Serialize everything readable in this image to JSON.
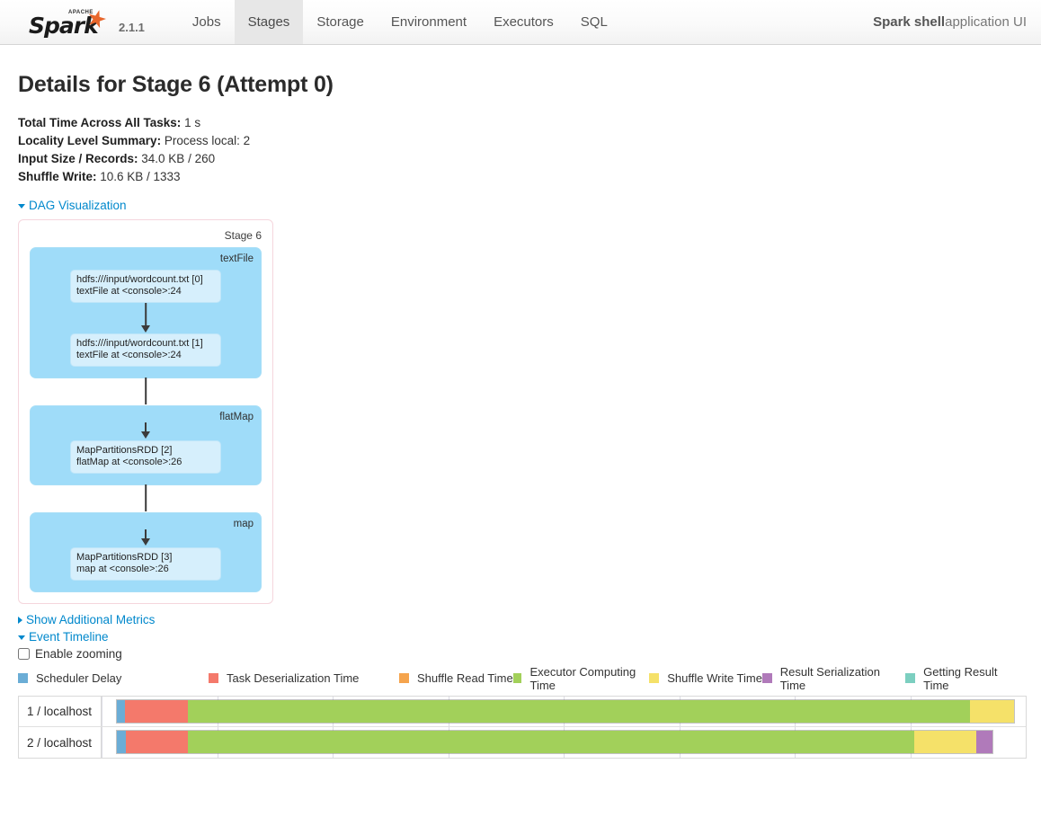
{
  "navbar": {
    "brand": {
      "apache_text": "APACHE",
      "spark_text": "Spark",
      "star_icon": "star-icon",
      "version": "2.1.1"
    },
    "links": [
      {
        "label": "Jobs",
        "active": false
      },
      {
        "label": "Stages",
        "active": true
      },
      {
        "label": "Storage",
        "active": false
      },
      {
        "label": "Environment",
        "active": false
      },
      {
        "label": "Executors",
        "active": false
      },
      {
        "label": "SQL",
        "active": false
      }
    ],
    "app_name": "Spark shell",
    "app_suffix": " application UI"
  },
  "page": {
    "title": "Details for Stage 6 (Attempt 0)",
    "summary": [
      {
        "label": "Total Time Across All Tasks:",
        "value": " 1 s"
      },
      {
        "label": "Locality Level Summary:",
        "value": " Process local: 2"
      },
      {
        "label": "Input Size / Records:",
        "value": " 34.0 KB / 260"
      },
      {
        "label": "Shuffle Write:",
        "value": " 10.6 KB / 1333"
      }
    ],
    "dag_toggle": "DAG Visualization",
    "additional_metrics_toggle": "Show Additional Metrics",
    "event_timeline_toggle": "Event Timeline",
    "enable_zooming_label": "Enable zooming",
    "enable_zooming_checked": false
  },
  "dag": {
    "stage_label": "Stage 6",
    "clusters": [
      {
        "label": "textFile",
        "nodes": [
          {
            "line1": "hdfs:///input/wordcount.txt [0]",
            "line2": "textFile at <console>:24"
          },
          {
            "line1": "hdfs:///input/wordcount.txt [1]",
            "line2": "textFile at <console>:24"
          }
        ]
      },
      {
        "label": "flatMap",
        "nodes": [
          {
            "line1": "MapPartitionsRDD [2]",
            "line2": "flatMap at <console>:26"
          }
        ]
      },
      {
        "label": "map",
        "nodes": [
          {
            "line1": "MapPartitionsRDD [3]",
            "line2": "map at <console>:26"
          }
        ]
      }
    ]
  },
  "legend": [
    {
      "label": "Scheduler Delay",
      "color": "#6badd6"
    },
    {
      "label": "Task Deserialization Time",
      "color": "#f4796b"
    },
    {
      "label": "Shuffle Read Time",
      "color": "#f5a44d"
    },
    {
      "label": "Executor Computing Time",
      "color": "#a2d05a"
    },
    {
      "label": "Shuffle Write Time",
      "color": "#f5e169"
    },
    {
      "label": "Result Serialization Time",
      "color": "#b07aba"
    },
    {
      "label": "Getting Result Time",
      "color": "#7ccfc0"
    }
  ],
  "timeline": {
    "gridlines_pct": [
      0,
      12.5,
      25,
      37.5,
      50,
      62.5,
      75,
      87.5,
      100
    ],
    "rows": [
      {
        "label": "1 / localhost",
        "start_pct": 1.6,
        "end_pct": 98.8,
        "segments": [
          {
            "name": "Scheduler Delay",
            "color": "#6badd6",
            "width_pct": 0.9
          },
          {
            "name": "Task Deserialization Time",
            "color": "#f4796b",
            "width_pct": 7.0
          },
          {
            "name": "Executor Computing Time",
            "color": "#a2d05a",
            "width_pct": 87.2
          },
          {
            "name": "Shuffle Write Time",
            "color": "#f5e169",
            "width_pct": 4.9
          }
        ]
      },
      {
        "label": "2 / localhost",
        "start_pct": 1.6,
        "end_pct": 96.5,
        "segments": [
          {
            "name": "Scheduler Delay",
            "color": "#6badd6",
            "width_pct": 1.0
          },
          {
            "name": "Task Deserialization Time",
            "color": "#f4796b",
            "width_pct": 7.1
          },
          {
            "name": "Executor Computing Time",
            "color": "#a2d05a",
            "width_pct": 83.0
          },
          {
            "name": "Shuffle Write Time",
            "color": "#f5e169",
            "width_pct": 7.1
          },
          {
            "name": "Result Serialization Time",
            "color": "#b07aba",
            "width_pct": 1.8
          }
        ]
      }
    ]
  }
}
